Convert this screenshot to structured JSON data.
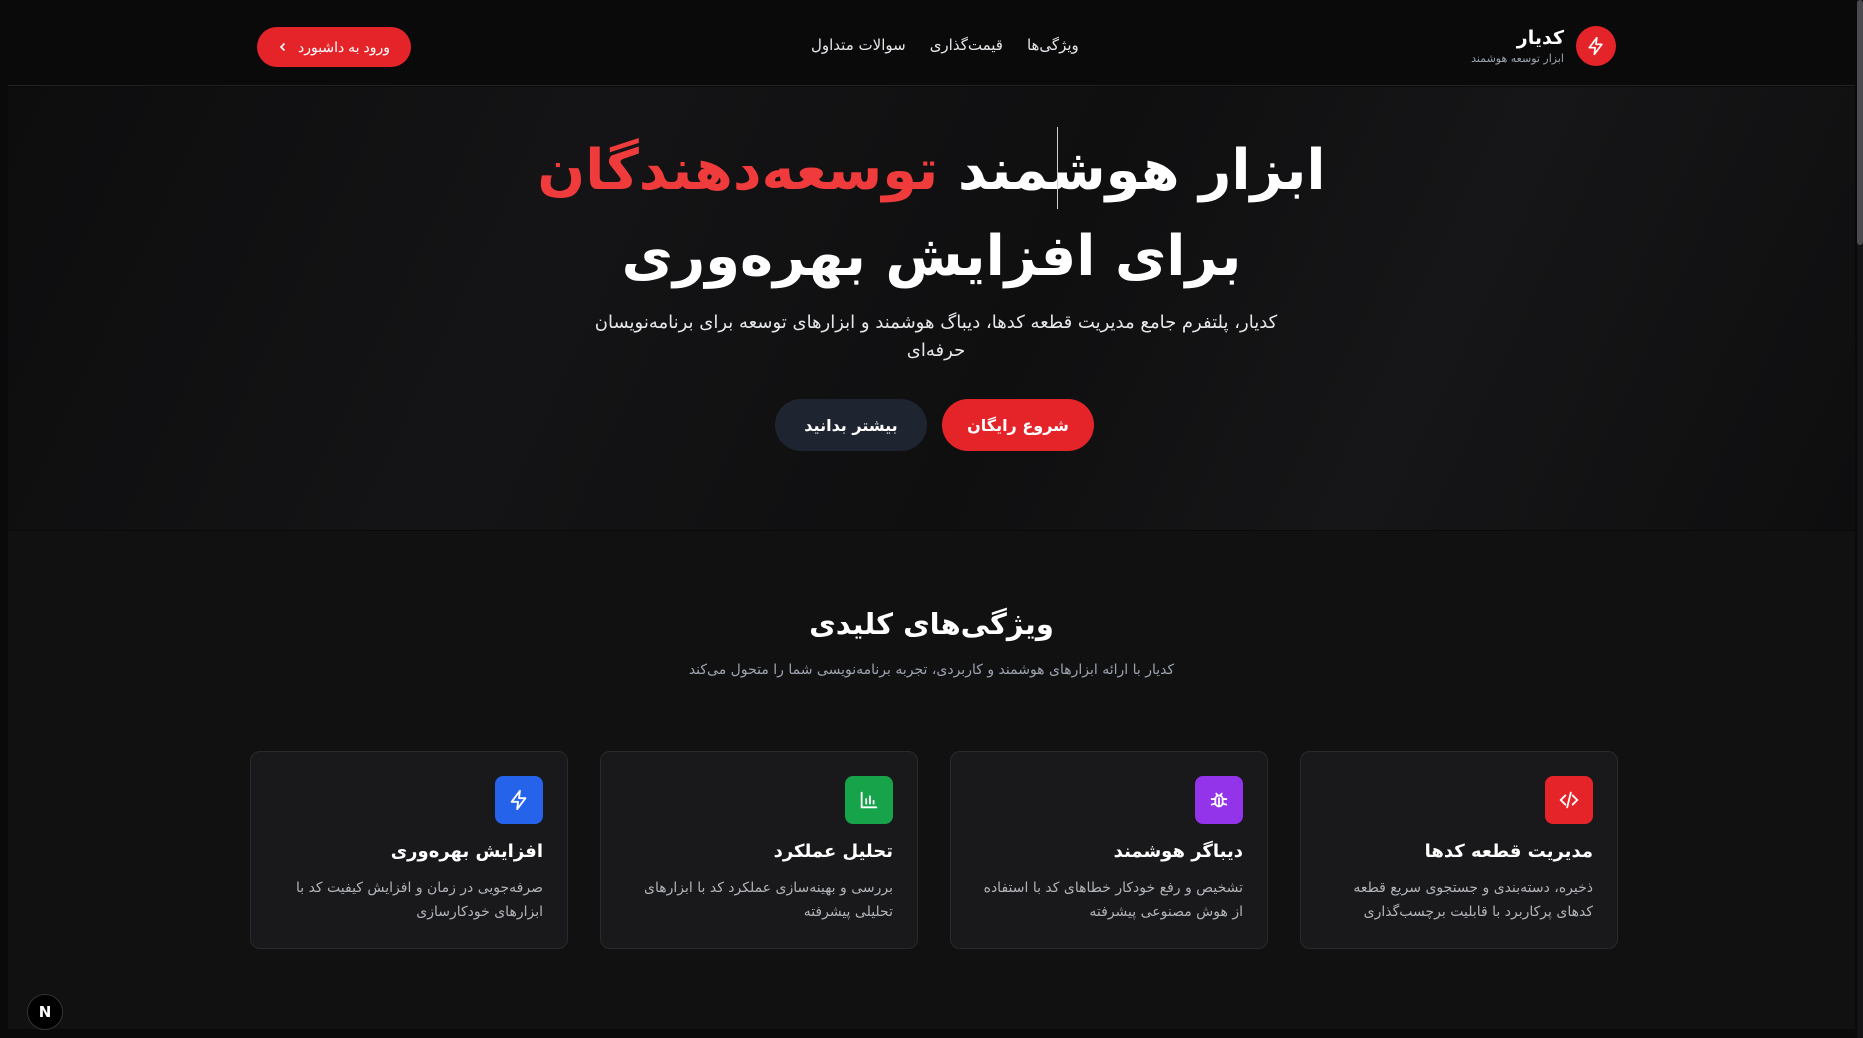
{
  "header": {
    "brand_name": "کدیار",
    "brand_tagline": "ابزار توسعه هوشمند",
    "nav": [
      "ویژگی‌ها",
      "قیمت‌گذاری",
      "سوالات متداول"
    ],
    "login_label": "ورود به داشبورد"
  },
  "hero": {
    "title_part1": "ابزار هوشمند",
    "title_accent": "توسعه‌دهندگان",
    "title_line2": "برای افزایش بهره‌وری",
    "description": "کدیار، پلتفرم جامع مدیریت قطعه کدها، دیباگ هوشمند و ابزارهای توسعه برای برنامه‌نویسان حرفه‌ای",
    "cta_primary": "شروع رایگان",
    "cta_secondary": "بیشتر بدانید"
  },
  "features": {
    "title": "ویژگی‌های کلیدی",
    "subtitle": "کدیار با ارائه ابزارهای هوشمند و کاربردی، تجربه برنامه‌نویسی شما را متحول می‌کند",
    "cards": [
      {
        "title": "مدیریت قطعه کدها",
        "desc": "ذخیره، دسته‌بندی و جستجوی سریع قطعه کدهای پرکاربرد با قابلیت برچسب‌گذاری",
        "icon": "code-icon",
        "color": "#e5242a"
      },
      {
        "title": "دیباگر هوشمند",
        "desc": "تشخیص و رفع خودکار خطاهای کد با استفاده از هوش مصنوعی پیشرفته",
        "icon": "bug-icon",
        "color": "#9333ea"
      },
      {
        "title": "تحلیل عملکرد",
        "desc": "بررسی و بهینه‌سازی عملکرد کد با ابزارهای تحلیلی پیشرفته",
        "icon": "bar-chart-icon",
        "color": "#16a34a"
      },
      {
        "title": "افزایش بهره‌وری",
        "desc": "صرفه‌جویی در زمان و افزایش کیفیت کد با ابزارهای خودکارسازی",
        "icon": "lightning-icon",
        "color": "#2563eb"
      }
    ]
  },
  "dev_badge": "N"
}
